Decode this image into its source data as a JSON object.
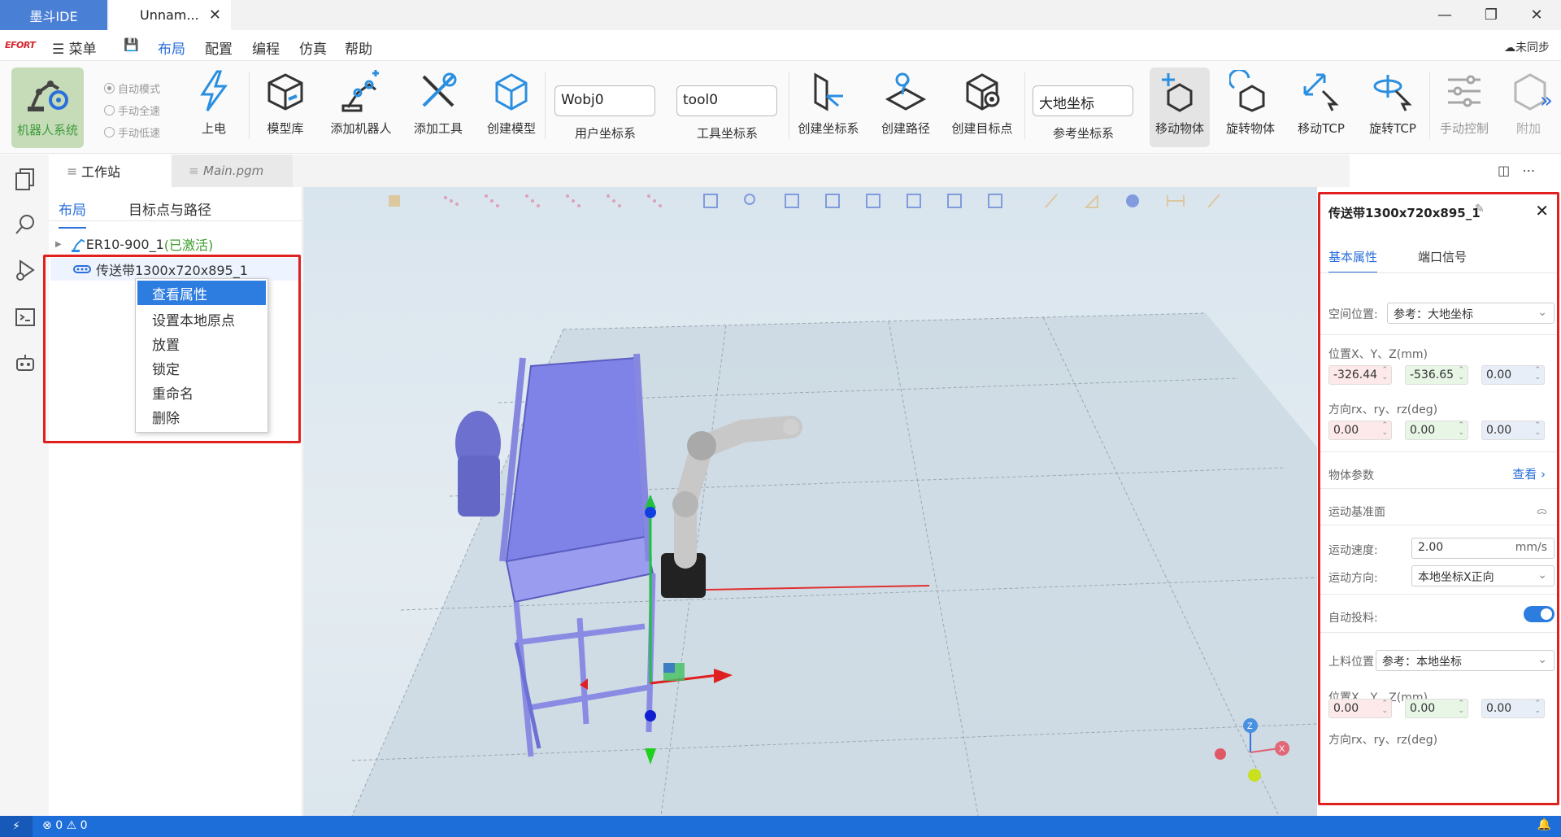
{
  "titlebar": {
    "app_tab": "墨斗IDE",
    "doc_tab": "Unnam...",
    "close": "✕",
    "minimize": "—",
    "restore": "❐",
    "close_win": "✕"
  },
  "menubar": {
    "logo": "EFORT",
    "menu": "菜单",
    "items": [
      "布局",
      "配置",
      "编程",
      "仿真",
      "帮助"
    ],
    "sync": "未同步"
  },
  "ribbon": {
    "robot_system": "机器人系统",
    "modes": [
      "自动模式",
      "手动全速",
      "手动低速"
    ],
    "power": "上电",
    "model_lib": "模型库",
    "add_robot": "添加机器人",
    "add_tool": "添加工具",
    "create_model": "创建模型",
    "wobj": {
      "value": "Wobj0",
      "label": "用户坐标系"
    },
    "tool": {
      "value": "tool0",
      "label": "工具坐标系"
    },
    "create_frame": "创建坐标系",
    "create_path": "创建路径",
    "create_target": "创建目标点",
    "ref": {
      "value": "大地坐标",
      "label": "参考坐标系"
    },
    "move_object": "移动物体",
    "rotate_object": "旋转物体",
    "move_tcp": "移动TCP",
    "rotate_tcp": "旋转TCP",
    "manual_control": "手动控制",
    "attach": "附加",
    "more": "»"
  },
  "doctabs": {
    "workstation": "工作站",
    "main": "Main.pgm"
  },
  "panel": {
    "tabs": [
      "布局",
      "目标点与路径"
    ],
    "tree": {
      "robot": "ER10-900_1",
      "robot_state": "(已激活)",
      "conveyor": "传送带1300x720x895_1"
    },
    "context_menu": [
      "查看属性",
      "设置本地原点",
      "放置",
      "锁定",
      "重命名",
      "删除"
    ]
  },
  "props": {
    "title": "传送带1300x720x895_1",
    "tabs": [
      "基本属性",
      "端口信号"
    ],
    "space_pos_label": "空间位置:",
    "space_pos_value": "参考：大地坐标",
    "pos_label": "位置X、Y、Z(mm)",
    "pos": [
      "-326.44",
      "-536.65",
      "0.00"
    ],
    "rot_label": "方向rx、ry、rz(deg)",
    "rot": [
      "0.00",
      "0.00",
      "0.00"
    ],
    "obj_params": "物体参数",
    "view": "查看",
    "motion_plane": "运动基准面",
    "speed_label": "运动速度:",
    "speed_value": "2.00",
    "speed_unit": "mm/s",
    "dir_label": "运动方向:",
    "dir_value": "本地坐标X正向",
    "auto_feed": "自动投料:",
    "auto_feed_on": true,
    "feed_pos_label": "上料位置",
    "feed_pos_value": "参考：本地坐标",
    "pos2_label": "位置X、Y、Z(mm)",
    "pos2": [
      "0.00",
      "0.00",
      "0.00"
    ],
    "rot2_label": "方向rx、ry、rz(deg)"
  },
  "statusbar": {
    "errors": "0",
    "warnings": "0"
  },
  "colors": {
    "accent": "#2a6fdb",
    "status_bar": "#1d6ed8",
    "highlight_box": "#e01f1f",
    "conveyor": "#7d7fe0"
  }
}
